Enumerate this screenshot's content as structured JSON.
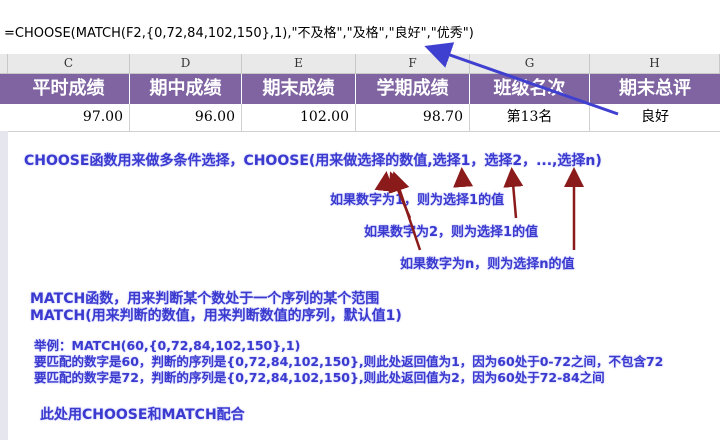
{
  "formula_bar": {
    "formula": "=CHOOSE(MATCH(F2,{0,72,84,102,150},1),\"不及格\",\"及格\",\"良好\",\"优秀\")"
  },
  "sheet": {
    "column_letters": [
      "C",
      "D",
      "E",
      "F",
      "G",
      "H"
    ],
    "headers": [
      "平时成绩",
      "期中成绩",
      "期末成绩",
      "学期成绩",
      "班级名次",
      "期末总评"
    ],
    "row": [
      "97.00",
      "96.00",
      "102.00",
      "98.70",
      "第13名",
      "良好"
    ],
    "header_color": "#8064a2"
  },
  "annotations": {
    "choose_intro": "CHOOSE函数用来做多条件选择，CHOOSE(用来做选择的数值,选择1，选择2，...,选择n)",
    "choose_note1": "如果数字为1，则为选择1的值",
    "choose_note2": "如果数字为2，则为选择1的值",
    "choose_note3": "如果数字为n，则为选择n的值",
    "match_intro": "MATCH函数，用来判断某个数处于一个序列的某个范围",
    "match_syntax": "MATCH(用来判断的数值，用来判断数值的序列，默认值1)",
    "example_title": "举例：MATCH(60,{0,72,84,102,150},1)",
    "example_line1": "要匹配的数字是60，判断的序列是{0,72,84,102,150},则此处返回值为1，因为60处于0-72之间，不包含72",
    "example_line2": "要匹配的数字是72，判断的序列是{0,72,84,102,150},则此处返回值为2，因为60处于72-84之间",
    "combo_note": "此处用CHOOSE和MATCH配合"
  },
  "colors": {
    "annotation_text": "#3a3acf",
    "arrow": "#8b1a1a",
    "pointer_arrow": "#4040d0"
  }
}
